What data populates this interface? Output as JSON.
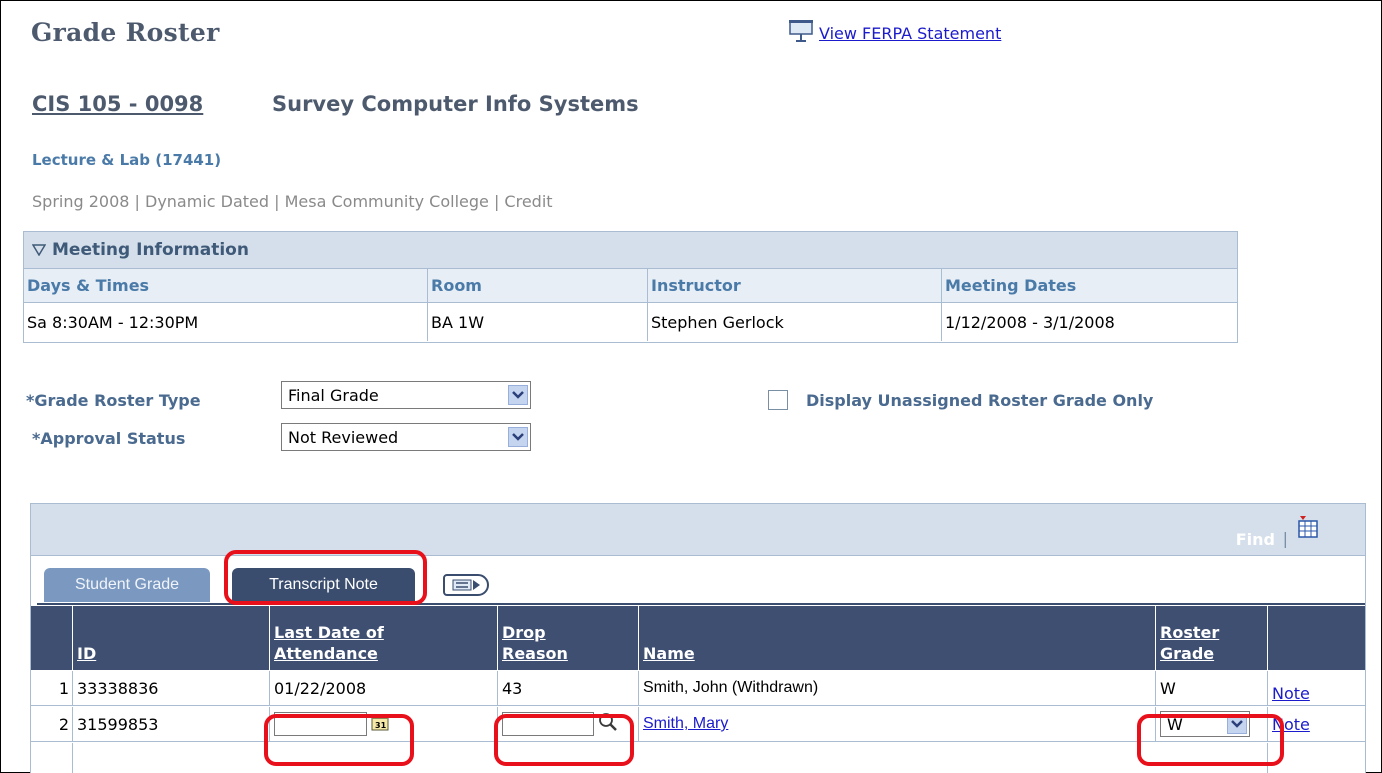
{
  "header": {
    "title": "Grade Roster",
    "ferpa_link": "View FERPA Statement"
  },
  "course": {
    "code": "CIS 105 - 0098",
    "title": "Survey Computer Info Systems",
    "section": "Lecture & Lab  (17441)",
    "term_info": "Spring 2008 | Dynamic Dated | Mesa Community College | Credit"
  },
  "meeting": {
    "heading": "Meeting Information",
    "columns": [
      "Days & Times",
      "Room",
      "Instructor",
      "Meeting Dates"
    ],
    "row": [
      "Sa 8:30AM - 12:30PM",
      "BA 1W",
      "Stephen Gerlock",
      "1/12/2008 - 3/1/2008"
    ]
  },
  "filters": {
    "roster_type_label": "*Grade Roster Type",
    "roster_type_value": "Final Grade",
    "approval_label": "*Approval Status",
    "approval_value": "Not Reviewed",
    "unassigned_label": "Display Unassigned Roster Grade Only",
    "unassigned_checked": false
  },
  "grid": {
    "find_label": "Find",
    "find_separator": "|",
    "tabs": [
      {
        "label": "Student Grade",
        "active": false
      },
      {
        "label": "Transcript Note",
        "active": true
      }
    ],
    "columns": {
      "id": "ID",
      "last_date": "Last Date of Attendance",
      "drop_reason": "Drop Reason",
      "name": "Name",
      "roster_grade": "Roster Grade"
    },
    "rows": [
      {
        "num": "1",
        "id": "33338836",
        "last_date": "01/22/2008",
        "drop_reason": "43",
        "name": "Smith, John (Withdrawn)",
        "grade": "W",
        "note": "Note"
      },
      {
        "num": "2",
        "id": "31599853",
        "last_date": "",
        "drop_reason": "",
        "name": "Smith, Mary",
        "grade": "W",
        "note": "Note"
      }
    ]
  },
  "icons": {
    "ferpa": "projector-screen-icon",
    "meeting_toggle": "triangle-down-icon",
    "download": "spreadsheet-download-icon",
    "show_all": "show-all-columns-icon",
    "calendar": "calendar-icon",
    "lookup": "magnifier-icon",
    "dropdown": "chevron-down-icon"
  },
  "colors": {
    "title": "#4d5a6e",
    "link": "#1b1bcc",
    "header_bg": "#3f4f72",
    "highlight": "#e8101a"
  }
}
